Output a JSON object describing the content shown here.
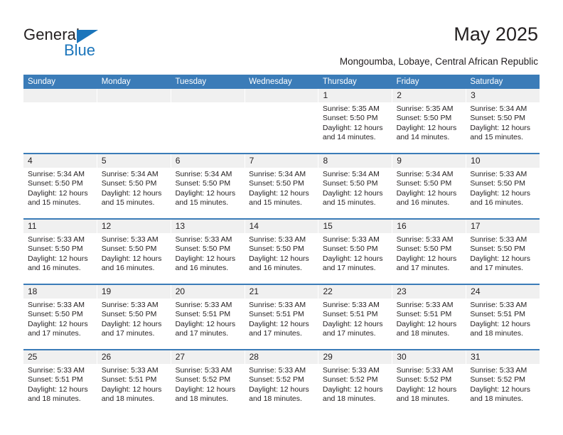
{
  "brand": {
    "name_part1": "General",
    "name_part2": "Blue",
    "triangle_color": "#1b75bb",
    "text_color": "#231f20"
  },
  "header": {
    "title": "May 2025",
    "subtitle": "Mongoumba, Lobaye, Central African Republic"
  },
  "colors": {
    "header_blue": "#3b7cb8",
    "daynum_band": "#f0f0f0",
    "text": "#231f20",
    "cell_background": "#ffffff"
  },
  "calendar": {
    "weekdays": [
      "Sunday",
      "Monday",
      "Tuesday",
      "Wednesday",
      "Thursday",
      "Friday",
      "Saturday"
    ],
    "weeks": [
      [
        {
          "day": "",
          "lines": [
            "",
            "",
            "",
            ""
          ]
        },
        {
          "day": "",
          "lines": [
            "",
            "",
            "",
            ""
          ]
        },
        {
          "day": "",
          "lines": [
            "",
            "",
            "",
            ""
          ]
        },
        {
          "day": "",
          "lines": [
            "",
            "",
            "",
            ""
          ]
        },
        {
          "day": "1",
          "lines": [
            "Sunrise: 5:35 AM",
            "Sunset: 5:50 PM",
            "Daylight: 12 hours",
            "and 14 minutes."
          ]
        },
        {
          "day": "2",
          "lines": [
            "Sunrise: 5:35 AM",
            "Sunset: 5:50 PM",
            "Daylight: 12 hours",
            "and 14 minutes."
          ]
        },
        {
          "day": "3",
          "lines": [
            "Sunrise: 5:34 AM",
            "Sunset: 5:50 PM",
            "Daylight: 12 hours",
            "and 15 minutes."
          ]
        }
      ],
      [
        {
          "day": "4",
          "lines": [
            "Sunrise: 5:34 AM",
            "Sunset: 5:50 PM",
            "Daylight: 12 hours",
            "and 15 minutes."
          ]
        },
        {
          "day": "5",
          "lines": [
            "Sunrise: 5:34 AM",
            "Sunset: 5:50 PM",
            "Daylight: 12 hours",
            "and 15 minutes."
          ]
        },
        {
          "day": "6",
          "lines": [
            "Sunrise: 5:34 AM",
            "Sunset: 5:50 PM",
            "Daylight: 12 hours",
            "and 15 minutes."
          ]
        },
        {
          "day": "7",
          "lines": [
            "Sunrise: 5:34 AM",
            "Sunset: 5:50 PM",
            "Daylight: 12 hours",
            "and 15 minutes."
          ]
        },
        {
          "day": "8",
          "lines": [
            "Sunrise: 5:34 AM",
            "Sunset: 5:50 PM",
            "Daylight: 12 hours",
            "and 15 minutes."
          ]
        },
        {
          "day": "9",
          "lines": [
            "Sunrise: 5:34 AM",
            "Sunset: 5:50 PM",
            "Daylight: 12 hours",
            "and 16 minutes."
          ]
        },
        {
          "day": "10",
          "lines": [
            "Sunrise: 5:33 AM",
            "Sunset: 5:50 PM",
            "Daylight: 12 hours",
            "and 16 minutes."
          ]
        }
      ],
      [
        {
          "day": "11",
          "lines": [
            "Sunrise: 5:33 AM",
            "Sunset: 5:50 PM",
            "Daylight: 12 hours",
            "and 16 minutes."
          ]
        },
        {
          "day": "12",
          "lines": [
            "Sunrise: 5:33 AM",
            "Sunset: 5:50 PM",
            "Daylight: 12 hours",
            "and 16 minutes."
          ]
        },
        {
          "day": "13",
          "lines": [
            "Sunrise: 5:33 AM",
            "Sunset: 5:50 PM",
            "Daylight: 12 hours",
            "and 16 minutes."
          ]
        },
        {
          "day": "14",
          "lines": [
            "Sunrise: 5:33 AM",
            "Sunset: 5:50 PM",
            "Daylight: 12 hours",
            "and 16 minutes."
          ]
        },
        {
          "day": "15",
          "lines": [
            "Sunrise: 5:33 AM",
            "Sunset: 5:50 PM",
            "Daylight: 12 hours",
            "and 17 minutes."
          ]
        },
        {
          "day": "16",
          "lines": [
            "Sunrise: 5:33 AM",
            "Sunset: 5:50 PM",
            "Daylight: 12 hours",
            "and 17 minutes."
          ]
        },
        {
          "day": "17",
          "lines": [
            "Sunrise: 5:33 AM",
            "Sunset: 5:50 PM",
            "Daylight: 12 hours",
            "and 17 minutes."
          ]
        }
      ],
      [
        {
          "day": "18",
          "lines": [
            "Sunrise: 5:33 AM",
            "Sunset: 5:50 PM",
            "Daylight: 12 hours",
            "and 17 minutes."
          ]
        },
        {
          "day": "19",
          "lines": [
            "Sunrise: 5:33 AM",
            "Sunset: 5:50 PM",
            "Daylight: 12 hours",
            "and 17 minutes."
          ]
        },
        {
          "day": "20",
          "lines": [
            "Sunrise: 5:33 AM",
            "Sunset: 5:51 PM",
            "Daylight: 12 hours",
            "and 17 minutes."
          ]
        },
        {
          "day": "21",
          "lines": [
            "Sunrise: 5:33 AM",
            "Sunset: 5:51 PM",
            "Daylight: 12 hours",
            "and 17 minutes."
          ]
        },
        {
          "day": "22",
          "lines": [
            "Sunrise: 5:33 AM",
            "Sunset: 5:51 PM",
            "Daylight: 12 hours",
            "and 17 minutes."
          ]
        },
        {
          "day": "23",
          "lines": [
            "Sunrise: 5:33 AM",
            "Sunset: 5:51 PM",
            "Daylight: 12 hours",
            "and 18 minutes."
          ]
        },
        {
          "day": "24",
          "lines": [
            "Sunrise: 5:33 AM",
            "Sunset: 5:51 PM",
            "Daylight: 12 hours",
            "and 18 minutes."
          ]
        }
      ],
      [
        {
          "day": "25",
          "lines": [
            "Sunrise: 5:33 AM",
            "Sunset: 5:51 PM",
            "Daylight: 12 hours",
            "and 18 minutes."
          ]
        },
        {
          "day": "26",
          "lines": [
            "Sunrise: 5:33 AM",
            "Sunset: 5:51 PM",
            "Daylight: 12 hours",
            "and 18 minutes."
          ]
        },
        {
          "day": "27",
          "lines": [
            "Sunrise: 5:33 AM",
            "Sunset: 5:52 PM",
            "Daylight: 12 hours",
            "and 18 minutes."
          ]
        },
        {
          "day": "28",
          "lines": [
            "Sunrise: 5:33 AM",
            "Sunset: 5:52 PM",
            "Daylight: 12 hours",
            "and 18 minutes."
          ]
        },
        {
          "day": "29",
          "lines": [
            "Sunrise: 5:33 AM",
            "Sunset: 5:52 PM",
            "Daylight: 12 hours",
            "and 18 minutes."
          ]
        },
        {
          "day": "30",
          "lines": [
            "Sunrise: 5:33 AM",
            "Sunset: 5:52 PM",
            "Daylight: 12 hours",
            "and 18 minutes."
          ]
        },
        {
          "day": "31",
          "lines": [
            "Sunrise: 5:33 AM",
            "Sunset: 5:52 PM",
            "Daylight: 12 hours",
            "and 18 minutes."
          ]
        }
      ]
    ]
  }
}
